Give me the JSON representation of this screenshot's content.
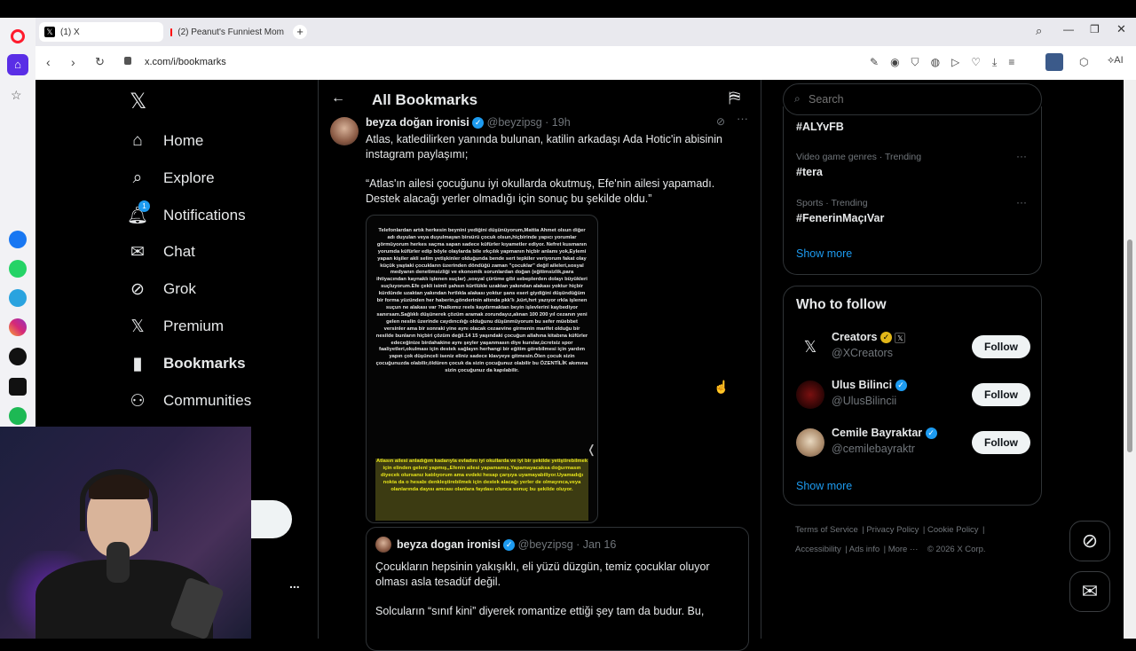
{
  "browser": {
    "tabs": [
      {
        "label": "(1) X",
        "active": true
      },
      {
        "label": "(2) Peanut's Funniest Mom",
        "active": false
      }
    ],
    "url": "x.com/i/bookmarks"
  },
  "nav": {
    "items": [
      {
        "label": "Home",
        "icon": "home-icon"
      },
      {
        "label": "Explore",
        "icon": "search-icon"
      },
      {
        "label": "Notifications",
        "icon": "bell-icon",
        "badge": "1"
      },
      {
        "label": "Chat",
        "icon": "mail-icon"
      },
      {
        "label": "Grok",
        "icon": "grok-icon"
      },
      {
        "label": "Premium",
        "icon": "x-logo-icon"
      },
      {
        "label": "Bookmarks",
        "icon": "bookmark-icon"
      },
      {
        "label": "Communities",
        "icon": "people-icon"
      }
    ],
    "more_dots": "..."
  },
  "header": {
    "title": "All Bookmarks"
  },
  "tweet": {
    "author": "beyza doğan ironisi",
    "handle": "@beyzipsg",
    "time": "· 19h",
    "text1": "Atlas, katledilirken yanında bulunan, katilin arkadaşı Ada Hotic'in abisinin instagram paylaşımı;",
    "text2": "“Atlas'ın ailesi çocuğunu iyi okullarda okutmuş, Efe'nin ailesi yapamadı. Destek alacağı yerler olmadığı için sonuç bu şekilde oldu.”",
    "image_text": "Telefonlardan artık herkesin beynini yediğini düşünüyorum,Mattia Ahmet olsun diğer adı duyulan veya duyulmayan birsürü çocuk olsun,hiçbirinde yapıcı yorumlar görmüyorum herkes saçma sapan sadece küfürler kıyametler ediyor. Nefret kusmanın yorumda küfürler edip böyle olaylarda bile ırkçılık yapmanın hiçbir anlamı yok,Eylemi yapan kişiler akli selim yetişkinler olduğunda bende sert tepkiler veriyorum fakat olay küçük yaştaki çocukların üzerinden döndüğü zaman \"çocuklar\" değil aileleri,sosyal medyanın denetimsizliği ve ekonomik sorunlardan doğan (eğitimsizlik,para ihtiyacından kaynaklı işlenen suçlar) ,sosyal çürüme gibi sebeplerden dolayı büyükleri suçluyorum.Efe çekli isimli şahsın kürtlükle uzaktan yakından alakası yoktur hiçbir kürdünde uzaktan yakından hırtlıkla alakası yoktur şans eseri giydiğini düşündüğüm bir forma yüzünden her haberin,gönderinin altında pkk'lı ,kürt,hırt yazıyor ırkla işlenen suçun ne alakası var ?halkımız reels kaydırmaktan beyin işlevlerini kaybediyor sanırsam.Sağlıklı düşünerek çözüm aramak zorundayız,alınan 100 200 yıl cezanın yeni gelen neslin üzerinde caydırıcılığı olduğunu düşünmüyorum bu sefer müebbet versinler ama bir sonraki yine aynı olacak cezaevine girmenin marifet olduğu bir nesilde bunların hiçbiri çözüm değil.14 15 yaşındaki çocuğun allahına kitabına küfürler edeceğinize birdahakine aynı şeyler yaşanmasın diye kurslar,ücretsiz spor faaliyetleri,okulması için destek sağlayın herhangi bir eğitim görebilmesi için yardım yapın çok düşünceli iseniz eliniz sadece klavyeye gitmesin.Ölen çocuk sizin çocuğunuzda olabilir,öldüren çocuk da sizin çocuğunuz olabilir bu ÖZENTİLİK akımına sizin çocuğunuz da kapılabilir.",
    "image_highlight": "Atlasın ailesi anladığım kadarıyla evladını iyi okullarda ve iyi bir şekilde yetiştirebilmek için elinden geleni yapmış,,Efenin ailesi yapamamış.Yapamayacaksa doğurmasın diyecek olursanız katılıyorum ama evdeki hesap çarşıya uyamayabiliyor.Uyamadığı nokta da o hesabı denkleştirebilmek için destek alacağı yerler de olmayınca,veya olanlarında dayısı amcası olanlara faydası olunca sonuç bu şekilde oluyor."
  },
  "quoted": {
    "author": "beyza dogan ironisi",
    "handle": "@beyzipsg",
    "time": "· Jan 16",
    "text1": "Çocukların hepsinin yakışıklı, eli yüzü düzgün, temiz çocuklar oluyor olması asla tesadüf değil.",
    "text2": "Solcuların “sınıf kini” diyerek romantize ettiği şey tam da budur. Bu,"
  },
  "search": {
    "placeholder": "Search"
  },
  "trends": {
    "first": "#ALYvFB",
    "items": [
      {
        "meta": "Video game genres · Trending",
        "name": "#tera"
      },
      {
        "meta": "Sports · Trending",
        "name": "#FenerinMaçıVar"
      }
    ],
    "show_more": "Show more"
  },
  "who_to_follow": {
    "title": "Who to follow",
    "users": [
      {
        "name": "Creators",
        "handle": "@XCreators",
        "badge": "gold"
      },
      {
        "name": "Ulus Bilinci",
        "handle": "@UlusBilincii",
        "badge": "blue"
      },
      {
        "name": "Cemile Bayraktar",
        "handle": "@cemilebayraktr",
        "badge": "blue"
      }
    ],
    "follow_label": "Follow",
    "show_more": "Show more"
  },
  "footer": {
    "links": [
      "Terms of Service",
      "Privacy Policy",
      "Cookie Policy",
      "Accessibility",
      "Ads info",
      "More ···",
      "© 2026 X Corp."
    ]
  },
  "colors": {
    "accent": "#1d9bf0",
    "gold": "#e2b719",
    "bg": "#000000",
    "text": "#e7e9ea",
    "muted": "#71767b"
  }
}
